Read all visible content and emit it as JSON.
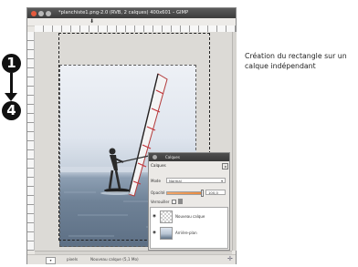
{
  "window": {
    "title": "*planchiste1.png-2.0 (RVB, 2 calques) 400x601 – GIMP",
    "close_color": "#e45a3d",
    "min_color": "#b9b9b9",
    "max_color": "#b9b9b9"
  },
  "statusbar": {
    "unit": "pixels",
    "message": "Nouveau calque (5,1 Mo)"
  },
  "layers_dock": {
    "title": "Calques",
    "tab_label": "Calques",
    "mode_label": "Mode",
    "mode_value": "Normal",
    "opacity_label": "Opacité",
    "opacity_value": "100,0",
    "opacity_fraction": 1.0,
    "lock_label": "Verrouiller",
    "layers": [
      {
        "name": "Nouveau calque",
        "thumbnail": "checkerboard"
      },
      {
        "name": "Arrière-plan",
        "thumbnail": "photo"
      }
    ]
  },
  "markers": {
    "start": "1",
    "end": "4"
  },
  "caption": "Création du rectangle sur un calque indépendant",
  "icons": {
    "eye": "eye-icon",
    "lock": "lock-icon",
    "navigate": "navigate-icon"
  }
}
